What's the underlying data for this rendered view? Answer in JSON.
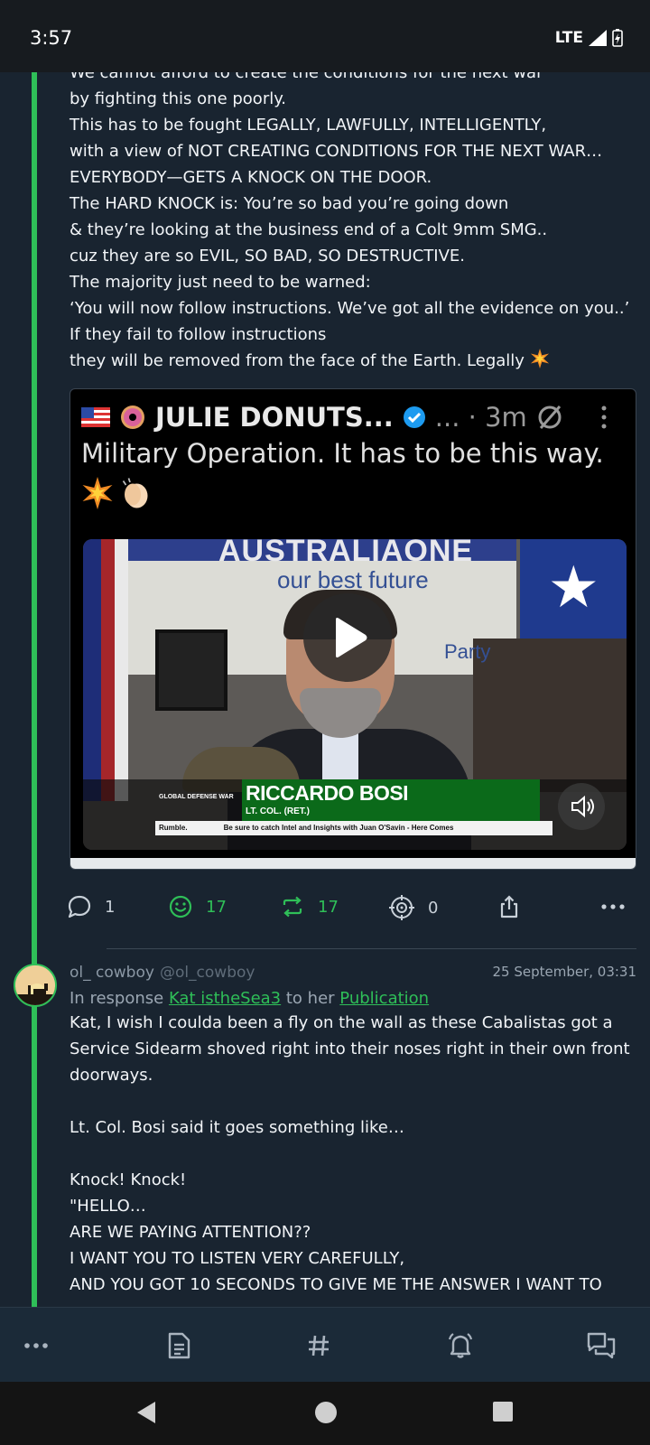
{
  "status_bar": {
    "time": "3:57",
    "network": "LTE"
  },
  "post": {
    "partial_line": "We cannot afford to create the conditions for the next war",
    "lines": [
      "by fighting this one poorly.",
      "This has to be fought LEGALLY, LAWFULLY, INTELLIGENTLY,",
      "with a view of NOT CREATING CONDITIONS FOR THE NEXT WAR…",
      "EVERYBODY—GETS A KNOCK ON THE DOOR.",
      "The HARD KNOCK is: You’re so bad you’re going down",
      "& they’re looking at the business end of a Colt 9mm SMG..",
      "cuz they are so EVIL, SO BAD, SO DESTRUCTIVE.",
      "The majority just need to be warned:",
      "‘You will now follow instructions. We’ve got all the evidence on you..’",
      "If they fail to follow instructions"
    ],
    "last_line": "they will be removed from the face of the Earth. Legally"
  },
  "media": {
    "author": "JULIE DONUTS...",
    "meta": "... · 3m",
    "caption": "Military Operation. It has to be this way.",
    "banner_title": "AUSTRALIAONE",
    "banner_subtitle": "our best future",
    "banner_party": "Party",
    "lower_third_org": "GLOBAL DEFENSE WAR",
    "lower_third_name": "RICCARDO BOSI",
    "lower_third_rank": "LT. COL. (RET.)",
    "ticker_source": "Rumble.",
    "ticker_text": "Be sure to catch Intel and Insights with Juan O'Savin - Here Comes"
  },
  "actions": {
    "comments": "1",
    "reactions": "17",
    "reposts": "17",
    "zaps": "0"
  },
  "reply": {
    "display_name": "ol_ cowboy",
    "handle": "@ol_cowboy",
    "date": "25 September, 03:31",
    "context_prefix": "In response",
    "context_user": "Kat istheSea3",
    "context_middle": "to her",
    "context_link": "Publication",
    "body_lines": [
      "Kat, I wish I coulda been a fly on the wall as these Cabalistas got a",
      "Service Sidearm shoved right into their noses right in their own front",
      "doorways.",
      "",
      "Lt. Col. Bosi said it goes something like…",
      "",
      "Knock! Knock!",
      "\"HELLO…",
      "ARE WE PAYING ATTENTION??",
      "I WANT YOU TO LISTEN VERY CAREFULLY,",
      "AND YOU GOT 10 SECONDS TO GIVE ME THE ANSWER I WANT TO"
    ]
  },
  "colors": {
    "accent": "#2fbf58",
    "background": "#192430",
    "nav_background": "#1b2a38"
  }
}
